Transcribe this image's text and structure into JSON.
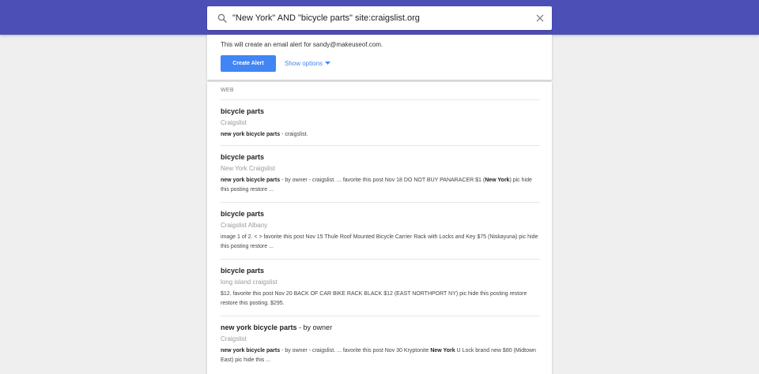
{
  "search": {
    "query": "\"New York\" AND \"bicycle parts\" site:craigslist.org"
  },
  "alert": {
    "text": "This will create an email alert for sandy@makeuseof.com.",
    "create_label": "Create Alert",
    "options_label": "Show options"
  },
  "results": {
    "section_label": "WEB",
    "items": [
      {
        "title": "bicycle parts",
        "title_suffix": "",
        "source": "Craigslist",
        "snippet_bold_1": "new york bicycle parts",
        "snippet_1": " - craigslist.",
        "snippet_bold_2": "",
        "snippet_2": ""
      },
      {
        "title": "bicycle parts",
        "title_suffix": "",
        "source": "New York Craigslist",
        "snippet_bold_1": "new york bicycle parts",
        "snippet_1": " - by owner - craigslist. ... favorite this post Nov 18 DO NOT BUY PANARACER $1 (",
        "snippet_bold_2": "New York",
        "snippet_2": ") pic hide this posting restore ..."
      },
      {
        "title": "bicycle parts",
        "title_suffix": "",
        "source": "Craigslist Albany",
        "snippet_bold_1": "",
        "snippet_1": "image 1 of 2. < > favorite this post Nov 15 Thule Roof Mounted Bicycle Carrier Rack with Locks and Key $75 (Niskayuna) pic hide this posting restore ...",
        "snippet_bold_2": "",
        "snippet_2": ""
      },
      {
        "title": "bicycle parts",
        "title_suffix": "",
        "source": "long island craigslist",
        "snippet_bold_1": "",
        "snippet_1": "$12. favorite this post Nov 20 BACK OF CAR BIKE RACK BLACK $12 (EAST NORTHPORT NY) pic hide this posting restore restore this posting. $295.",
        "snippet_bold_2": "",
        "snippet_2": ""
      },
      {
        "title": "new york bicycle parts",
        "title_suffix": " - by owner",
        "source": "Craigslist",
        "snippet_bold_1": "new york bicycle parts",
        "snippet_1": " - by owner - craigslist. ... favorite this post Nov 30 Kryptonite ",
        "snippet_bold_2": "New York",
        "snippet_2": " U Lock brand new $80 (Midtown East) pic hide this ..."
      }
    ]
  },
  "colors": {
    "topbar": "#4b4fb6",
    "accent": "#4285f4",
    "background": "#efefef"
  },
  "icons": {
    "search": "search-icon",
    "close": "close-icon",
    "dropdown": "caret-down-icon"
  }
}
